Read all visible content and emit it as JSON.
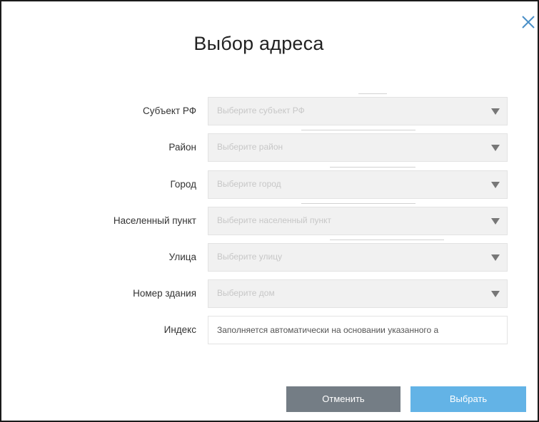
{
  "dialog": {
    "title": "Выбор адреса",
    "close_icon": "close-icon"
  },
  "fields": [
    {
      "label": "Субъект РФ",
      "placeholder": "Выберите субъект РФ"
    },
    {
      "label": "Район",
      "placeholder": "Выберите район"
    },
    {
      "label": "Город",
      "placeholder": "Выберите город"
    },
    {
      "label": "Населенный пункт",
      "placeholder": "Выберите населенный пункт"
    },
    {
      "label": "Улица",
      "placeholder": "Выберите улицу"
    },
    {
      "label": "Номер здания",
      "placeholder": "Выберите дом"
    }
  ],
  "index_field": {
    "label": "Индекс",
    "value": "Заполняется автоматически на основании указанного а"
  },
  "buttons": {
    "cancel": "Отменить",
    "select": "Выбрать"
  },
  "colors": {
    "cancel_bg": "#747d85",
    "select_bg": "#63b3e6"
  }
}
